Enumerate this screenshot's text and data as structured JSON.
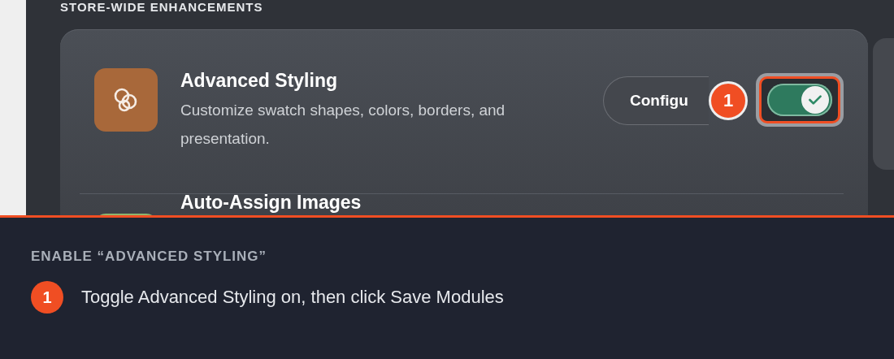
{
  "section": {
    "heading": "STORE-WIDE ENHANCEMENTS"
  },
  "modules": [
    {
      "title": "Advanced Styling",
      "description": "Customize swatch shapes, colors, borders, and presentation.",
      "color": "#a8683a",
      "configure_label": "Configu",
      "callout": "1",
      "toggle": {
        "on": true,
        "highlighted": true
      }
    },
    {
      "title": "Auto-Assign Images",
      "color": "#8fb56e"
    }
  ],
  "instructions": {
    "title": "ENABLE “ADVANCED STYLING”",
    "steps": [
      {
        "number": "1",
        "text": "Toggle Advanced Styling on, then click Save Modules"
      }
    ]
  }
}
